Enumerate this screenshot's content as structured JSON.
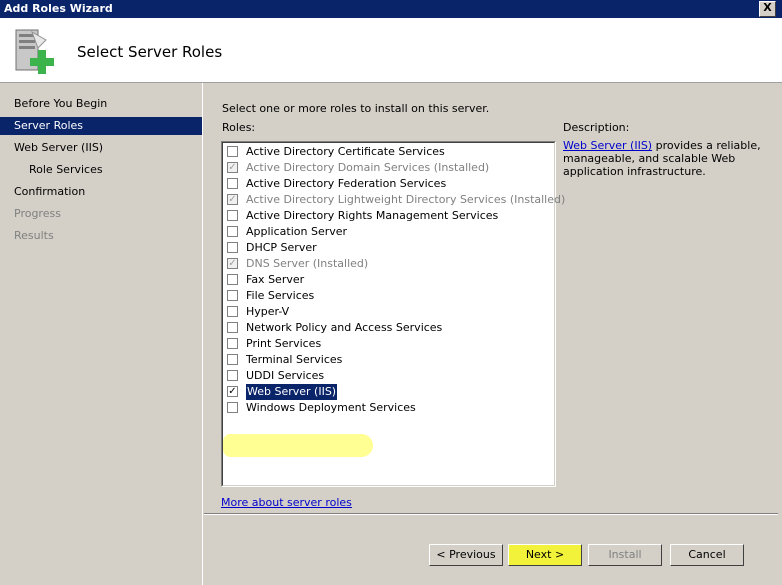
{
  "window": {
    "title": "Add Roles Wizard",
    "close_label": "X"
  },
  "header": {
    "title": "Select Server Roles"
  },
  "nav": {
    "items": [
      {
        "label": "Before You Begin",
        "state": "normal"
      },
      {
        "label": "Server Roles",
        "state": "active"
      },
      {
        "label": "Web Server (IIS)",
        "state": "normal"
      },
      {
        "label": "Role Services",
        "state": "sub"
      },
      {
        "label": "Confirmation",
        "state": "normal"
      },
      {
        "label": "Progress",
        "state": "disabled"
      },
      {
        "label": "Results",
        "state": "disabled"
      }
    ]
  },
  "main": {
    "instruction": "Select one or more roles to install on this server.",
    "roles_label": "Roles:",
    "roles": [
      {
        "label": "Active Directory Certificate Services",
        "checked": false,
        "installed": false
      },
      {
        "label": "Active Directory Domain Services  (Installed)",
        "checked": true,
        "installed": true
      },
      {
        "label": "Active Directory Federation Services",
        "checked": false,
        "installed": false
      },
      {
        "label": "Active Directory Lightweight Directory Services  (Installed)",
        "checked": true,
        "installed": true
      },
      {
        "label": "Active Directory Rights Management Services",
        "checked": false,
        "installed": false
      },
      {
        "label": "Application Server",
        "checked": false,
        "installed": false
      },
      {
        "label": "DHCP Server",
        "checked": false,
        "installed": false
      },
      {
        "label": "DNS Server  (Installed)",
        "checked": true,
        "installed": true
      },
      {
        "label": "Fax Server",
        "checked": false,
        "installed": false
      },
      {
        "label": "File Services",
        "checked": false,
        "installed": false
      },
      {
        "label": "Hyper-V",
        "checked": false,
        "installed": false
      },
      {
        "label": "Network Policy and Access Services",
        "checked": false,
        "installed": false
      },
      {
        "label": "Print Services",
        "checked": false,
        "installed": false
      },
      {
        "label": "Terminal Services",
        "checked": false,
        "installed": false
      },
      {
        "label": "UDDI Services",
        "checked": false,
        "installed": false
      },
      {
        "label": "Web Server (IIS)",
        "checked": true,
        "installed": false,
        "selected": true
      },
      {
        "label": "Windows Deployment Services",
        "checked": false,
        "installed": false
      }
    ],
    "description_label": "Description:",
    "description_link": "Web Server (IIS)",
    "description_text": " provides a reliable, manageable, and scalable Web application infrastructure.",
    "more_link": "More about server roles"
  },
  "buttons": {
    "previous": "< Previous",
    "next": "Next >",
    "install": "Install",
    "cancel": "Cancel"
  },
  "colors": {
    "titlebar": "#0a246a",
    "selection": "#0a246a",
    "highlighter": "#f2f23a",
    "link": "#0000cc"
  },
  "icons": {
    "header": "server-add-icon",
    "check": "checkmark-icon"
  }
}
